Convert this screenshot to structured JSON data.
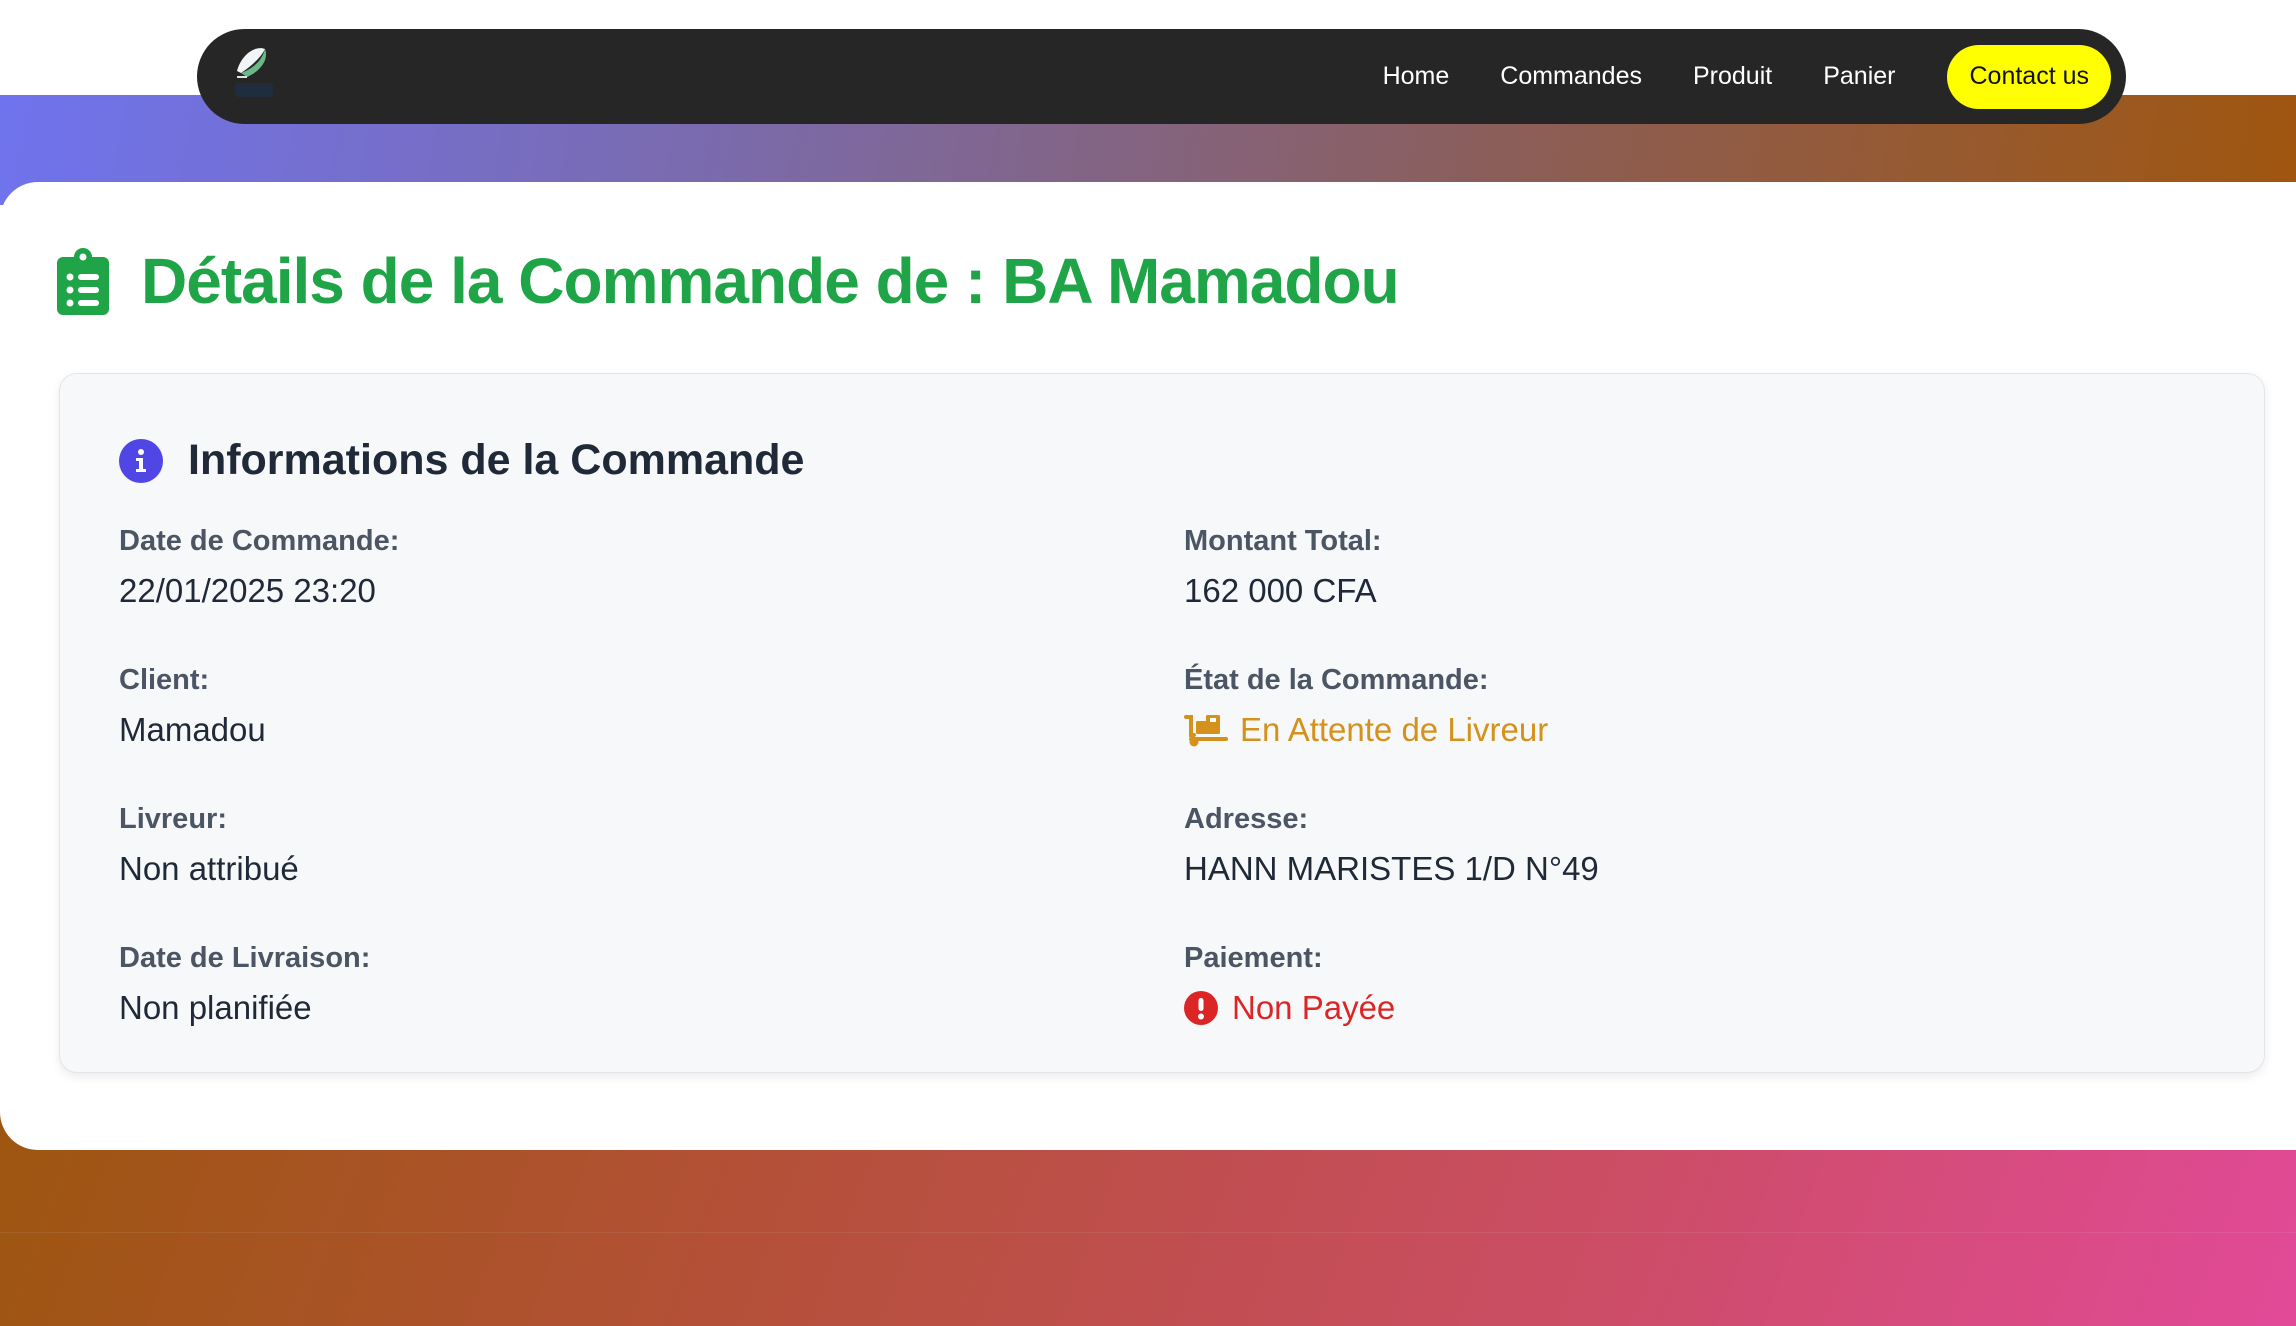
{
  "nav": {
    "links": [
      "Home",
      "Commandes",
      "Produit",
      "Panier"
    ],
    "contact_label": "Contact us"
  },
  "page": {
    "title": "Détails de la Commande de : BA Mamadou",
    "title_icon": "clipboard-list-icon"
  },
  "panel": {
    "title": "Informations de la Commande",
    "icon": "info-circle-icon",
    "fields": {
      "date_commande": {
        "label": "Date de Commande:",
        "value": "22/01/2025 23:20"
      },
      "montant_total": {
        "label": "Montant Total:",
        "value": "162 000 CFA"
      },
      "client": {
        "label": "Client:",
        "value": "Mamadou"
      },
      "etat": {
        "label": "État de la Commande:",
        "value": "En Attente de Livreur",
        "icon": "dolly-icon",
        "color": "#d4911c"
      },
      "livreur": {
        "label": "Livreur:",
        "value": "Non attribué"
      },
      "adresse": {
        "label": "Adresse:",
        "value": "HANN MARISTES 1/D N°49"
      },
      "date_livraison": {
        "label": "Date de Livraison:",
        "value": "Non planifiée"
      },
      "paiement": {
        "label": "Paiement:",
        "value": "Non Payée",
        "icon": "exclamation-circle-icon",
        "color": "#dc2626"
      }
    }
  },
  "colors": {
    "title_green": "#1fa447",
    "contact_yellow": "#ffff00",
    "navbar": "#262626",
    "info_purple": "#4f46e5"
  }
}
